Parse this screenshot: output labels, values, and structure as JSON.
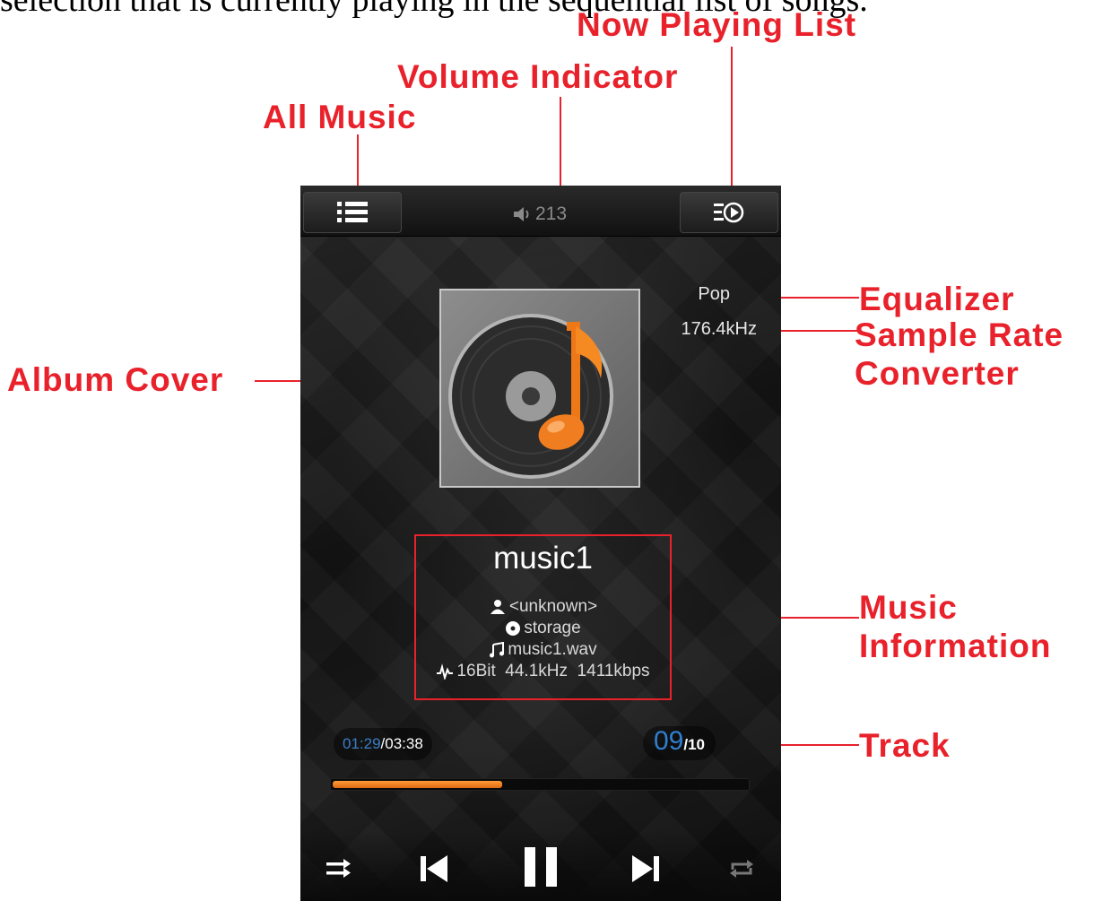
{
  "document": {
    "caption": "selection that is currently playing in the sequential list of songs."
  },
  "callouts": {
    "now_playing_list": "Now Playing List",
    "volume_indicator": "Volume Indicator",
    "all_music": "All Music",
    "equalizer": "Equalizer",
    "sample_rate_line1": "Sample Rate",
    "sample_rate_line2": "Converter",
    "album_cover": "Album Cover",
    "music_information_line1": "Music",
    "music_information_line2": "Information",
    "track": "Track"
  },
  "player": {
    "topbar": {
      "all_music_icon": "list-icon",
      "now_playing_icon": "playlist-play-icon",
      "volume_icon": "speaker-icon",
      "volume": "213"
    },
    "equalizer": "Pop",
    "sample_rate": "176.4kHz",
    "album_cover_icon": "disc-music-note-icon",
    "song": {
      "title": "music1",
      "artist": "<unknown>",
      "album": "storage",
      "file": "music1.wav",
      "format": "16Bit  44.1kHz  1411kbps"
    },
    "time": {
      "current": "01:29",
      "total": "/03:38"
    },
    "track": {
      "current": "09",
      "total": "/10"
    },
    "progress_fraction": 0.41,
    "controls": [
      "shuffle-icon",
      "previous-icon",
      "pause-icon",
      "next-icon",
      "repeat-icon"
    ],
    "colors": {
      "accent": "#f07d1f",
      "time_blue": "#3a7fc8",
      "callout_red": "#e8212b"
    }
  }
}
